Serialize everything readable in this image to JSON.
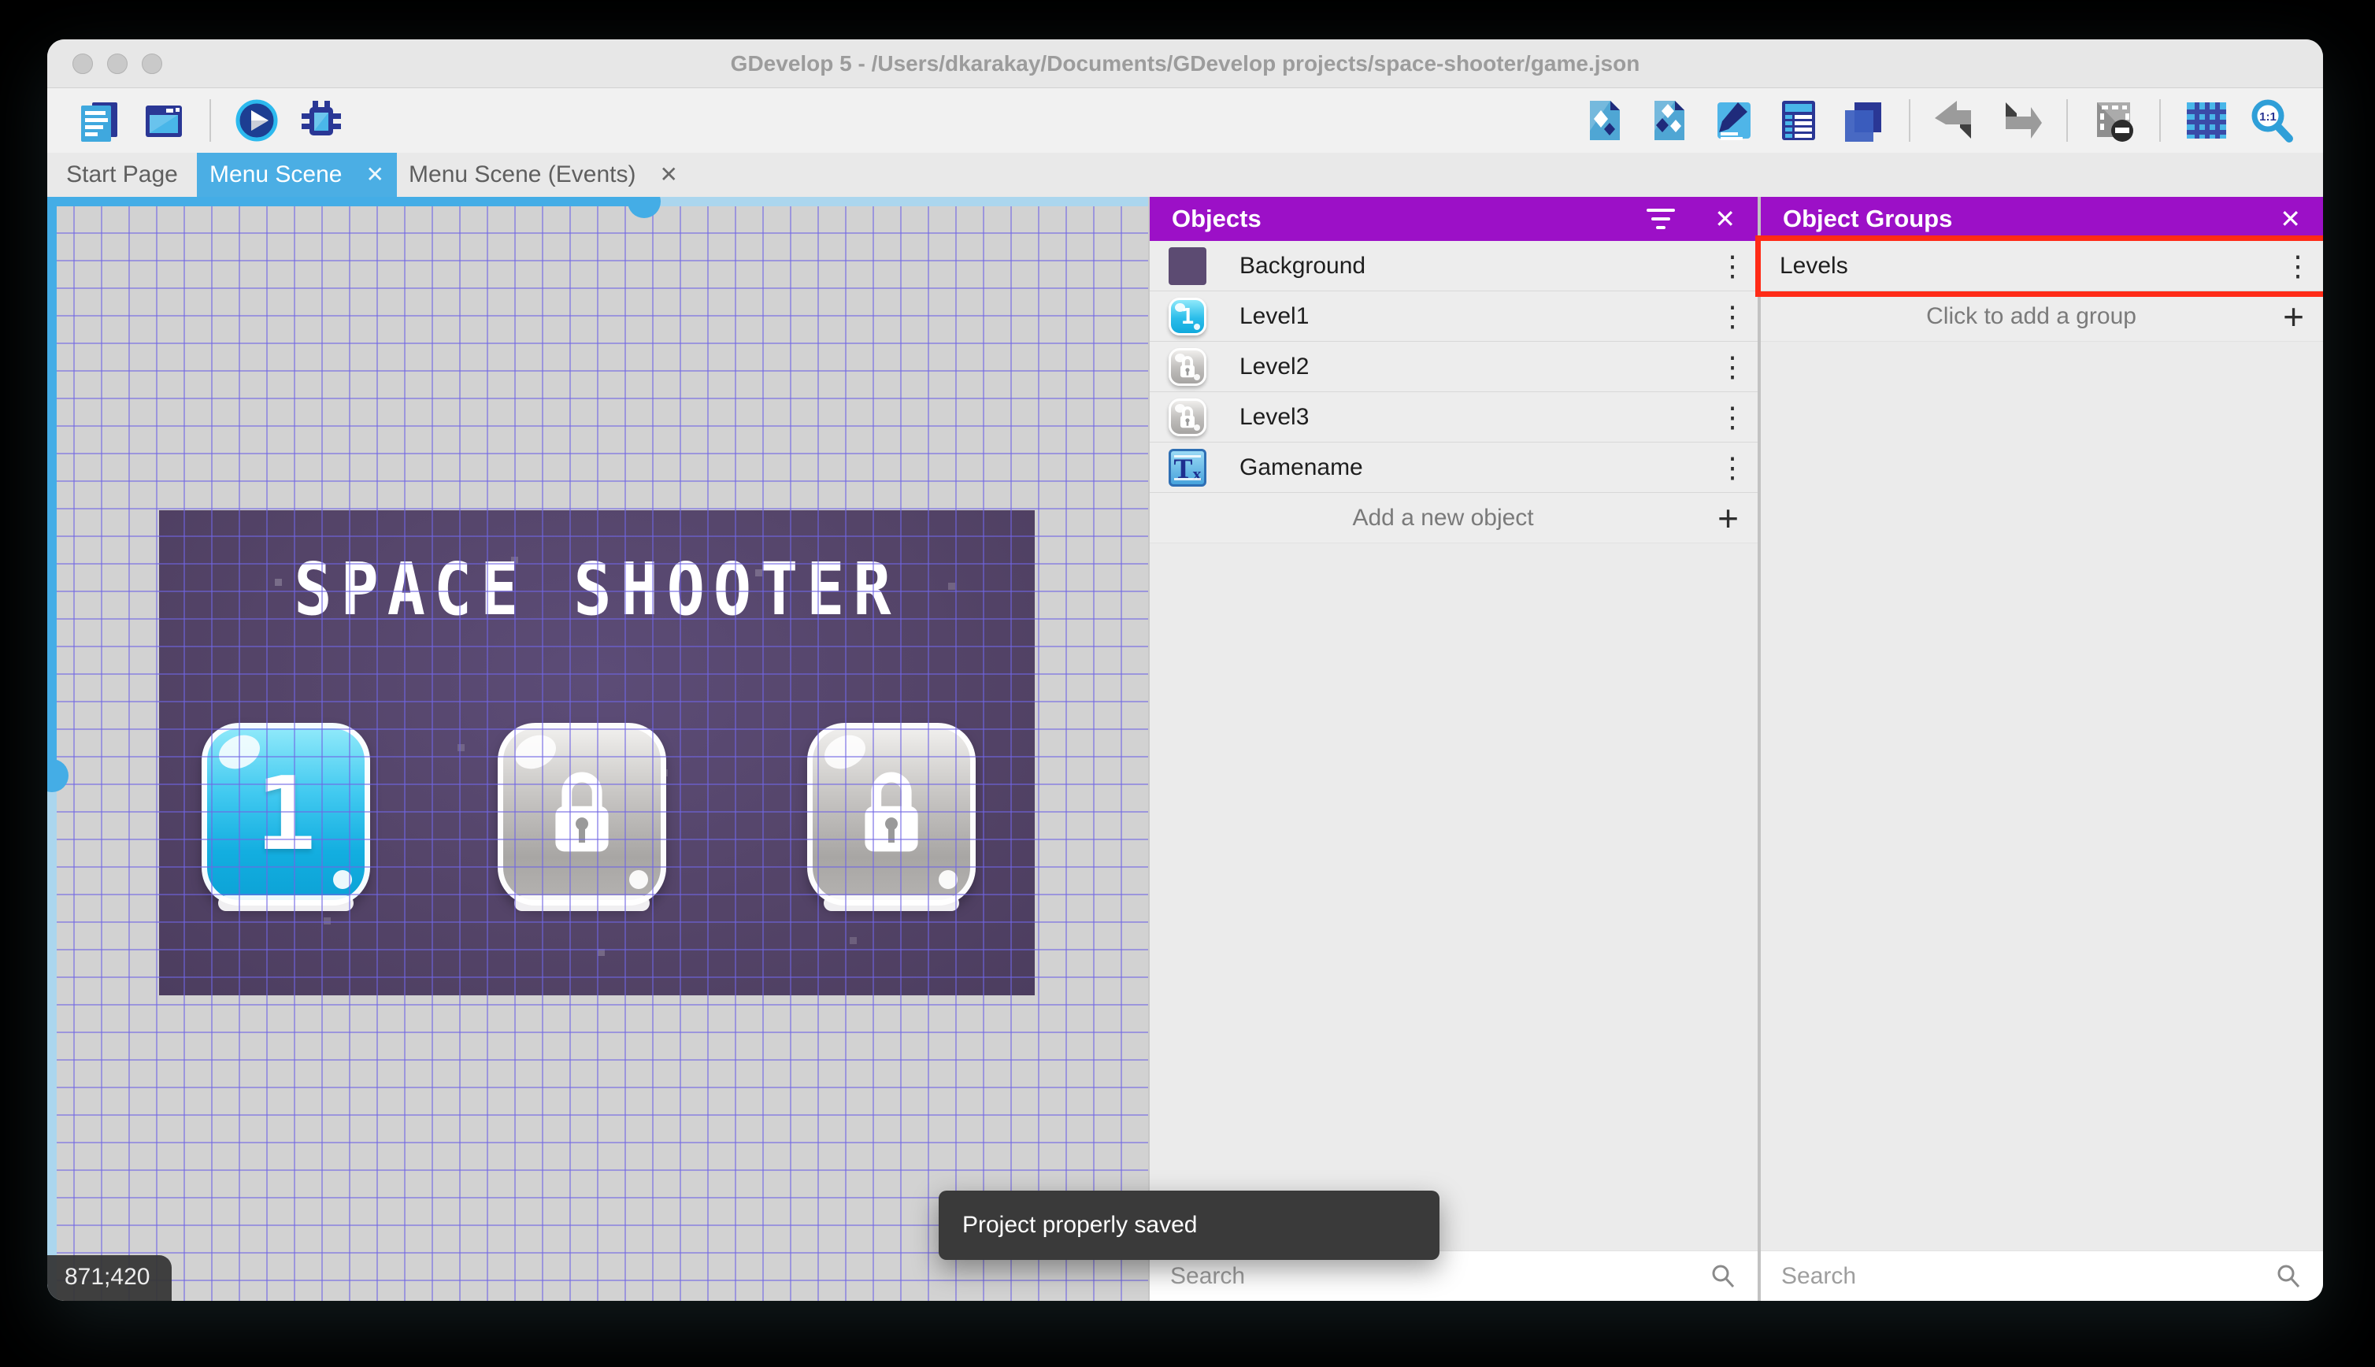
{
  "window": {
    "title": "GDevelop 5 - /Users/dkarakay/Documents/GDevelop projects/space-shooter/game.json"
  },
  "tabs": [
    {
      "label": "Start Page",
      "active": false,
      "closable": false
    },
    {
      "label": "Menu Scene",
      "active": true,
      "closable": true
    },
    {
      "label": "Menu Scene (Events)",
      "active": false,
      "closable": true
    }
  ],
  "toolbar": {
    "left_icons": [
      "project-manager",
      "scene-properties-window",
      "play",
      "debug"
    ],
    "right_icons": [
      "open-objects-editor",
      "open-object-groups-editor",
      "open-properties",
      "open-instances-list",
      "open-layers-editor",
      "undo",
      "redo",
      "toggle-window-mask",
      "toggle-grid",
      "zoom-original-1-1"
    ]
  },
  "glyphs": {
    "close": "✕",
    "kebab": "⋮",
    "plus": "+"
  },
  "scene": {
    "title": "SPACE SHOOTER",
    "buttons": [
      {
        "label": "1",
        "state": "unlocked"
      },
      {
        "label": "",
        "state": "locked"
      },
      {
        "label": "",
        "state": "locked"
      }
    ]
  },
  "canvas": {
    "coordinates": "871;420"
  },
  "toast": {
    "message": "Project properly saved"
  },
  "panels": {
    "objects": {
      "title": "Objects",
      "items": [
        {
          "name": "Background",
          "icon": "background-swatch"
        },
        {
          "name": "Level1",
          "icon": "level-1-button",
          "icon_label": "1"
        },
        {
          "name": "Level2",
          "icon": "locked-level-button"
        },
        {
          "name": "Level3",
          "icon": "locked-level-button"
        },
        {
          "name": "Gamename",
          "icon": "text-object"
        }
      ],
      "add_label": "Add a new object",
      "search_placeholder": "Search"
    },
    "groups": {
      "title": "Object Groups",
      "items": [
        {
          "name": "Levels",
          "highlighted": true
        }
      ],
      "add_label": "Click to add a group",
      "search_placeholder": "Search"
    }
  },
  "colors": {
    "panel_header_purple": "#9C10C7",
    "active_tab_blue": "#4BAEE4",
    "annotation_red": "#FF2B17",
    "scrollbar_blue": "#44ADE6",
    "scene_purple": "#544468"
  }
}
